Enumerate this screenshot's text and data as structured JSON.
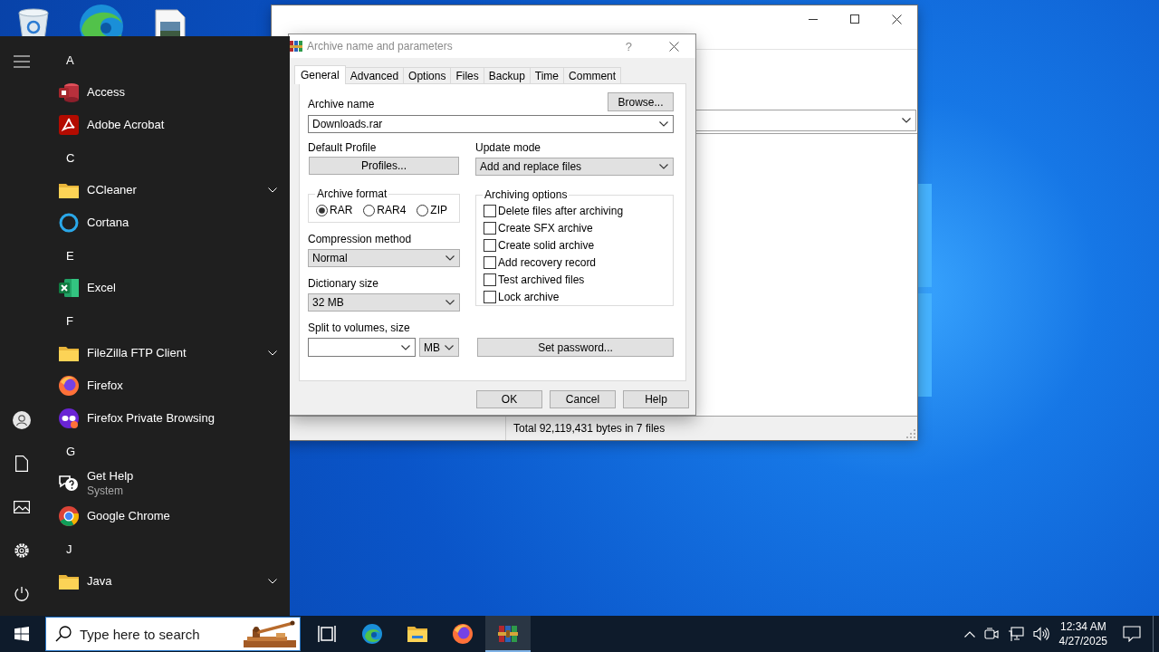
{
  "start_menu": {
    "groups": [
      {
        "letter": "A",
        "apps": [
          {
            "name": "Access",
            "kind": "access"
          },
          {
            "name": "Adobe Acrobat",
            "kind": "acrobat"
          }
        ]
      },
      {
        "letter": "C",
        "apps": [
          {
            "name": "CCleaner",
            "kind": "folder"
          },
          {
            "name": "Cortana",
            "kind": "cortana"
          }
        ]
      },
      {
        "letter": "E",
        "apps": [
          {
            "name": "Excel",
            "kind": "excel"
          }
        ]
      },
      {
        "letter": "F",
        "apps": [
          {
            "name": "FileZilla FTP Client",
            "kind": "folder"
          },
          {
            "name": "Firefox",
            "kind": "firefox"
          },
          {
            "name": "Firefox Private Browsing",
            "kind": "firefox-private"
          }
        ]
      },
      {
        "letter": "G",
        "apps": [
          {
            "name": "Get Help",
            "subtitle": "System",
            "kind": "get-help"
          },
          {
            "name": "Google Chrome",
            "kind": "chrome"
          }
        ]
      },
      {
        "letter": "J",
        "apps": [
          {
            "name": "Java",
            "kind": "folder"
          }
        ]
      }
    ]
  },
  "main_window": {
    "status_text": "Total 92,119,431 bytes in 7 files"
  },
  "dialog": {
    "title": "Archive name and parameters",
    "help_glyph": "?",
    "tabs": [
      {
        "label": "General",
        "selected": true
      },
      {
        "label": "Advanced",
        "selected": false
      },
      {
        "label": "Options",
        "selected": false
      },
      {
        "label": "Files",
        "selected": false
      },
      {
        "label": "Backup",
        "selected": false
      },
      {
        "label": "Time",
        "selected": false
      },
      {
        "label": "Comment",
        "selected": false
      }
    ],
    "archive_name_label": "Archive name",
    "browse_button": "Browse...",
    "archive_name": "Downloads.rar",
    "default_profile_label": "Default Profile",
    "profiles_button": "Profiles...",
    "update_mode_label": "Update mode",
    "update_mode": "Add and replace files",
    "archive_format": {
      "label": "Archive format",
      "options": [
        {
          "label": "RAR",
          "selected": true
        },
        {
          "label": "RAR4",
          "selected": false
        },
        {
          "label": "ZIP",
          "selected": false
        }
      ]
    },
    "compression_method_label": "Compression method",
    "compression_method": "Normal",
    "dictionary_size_label": "Dictionary size",
    "dictionary_size": "32 MB",
    "split_label": "Split to volumes, size",
    "split_unit": "MB",
    "archiving_options": {
      "label": "Archiving options",
      "options": [
        {
          "label": "Delete files after archiving",
          "checked": false
        },
        {
          "label": "Create SFX archive",
          "checked": false
        },
        {
          "label": "Create solid archive",
          "checked": false
        },
        {
          "label": "Add recovery record",
          "checked": false
        },
        {
          "label": "Test archived files",
          "checked": false
        },
        {
          "label": "Lock archive",
          "checked": false
        }
      ]
    },
    "password_button": "Set password...",
    "buttons": [
      "OK",
      "Cancel",
      "Help"
    ]
  },
  "taskbar": {
    "search_placeholder": "Type here to search",
    "apps": [
      {
        "kind": "task-view",
        "active": false
      },
      {
        "kind": "edge",
        "active": false
      },
      {
        "kind": "explorer",
        "active": false
      },
      {
        "kind": "firefox",
        "active": false
      },
      {
        "kind": "winrar",
        "active": true
      }
    ],
    "time": "12:34 AM",
    "date": "4/27/2025"
  }
}
